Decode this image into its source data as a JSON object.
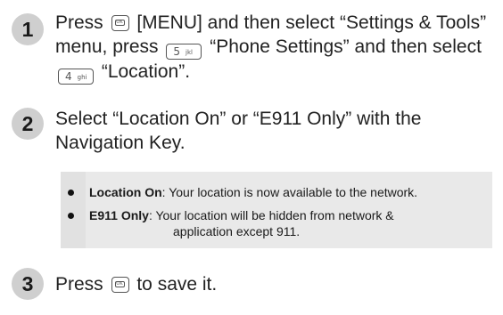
{
  "steps": [
    {
      "number": "1",
      "parts": {
        "a": "Press",
        "b": "[MENU] and then select “Settings & Tools” menu, press",
        "c": "“Phone Settings” and then select",
        "d": "“Location”."
      },
      "keys": {
        "ok": "OK",
        "five_digit": "5",
        "five_letters": "jkl",
        "four_digit": "4",
        "four_letters": "ghi"
      }
    },
    {
      "number": "2",
      "text": "Select “Location On” or “E911 Only” with the Navigation Key."
    },
    {
      "number": "3",
      "parts": {
        "a": "Press",
        "b": "to save it."
      },
      "keys": {
        "ok": "OK"
      }
    }
  ],
  "notes": [
    {
      "term": "Location On",
      "text": ": Your location is now available to the network."
    },
    {
      "term": "E911 Only",
      "text": ": Your location will be hidden from network &",
      "continuation": "application except 911."
    }
  ],
  "colors": {
    "badge_fill": "#cfcfcf",
    "badge_number": "#1a1a1a",
    "note_background": "#e9e9e9"
  },
  "icons": [
    "ok-key-icon",
    "5-jkl-key-icon",
    "4-ghi-key-icon",
    "bullet-icon"
  ]
}
